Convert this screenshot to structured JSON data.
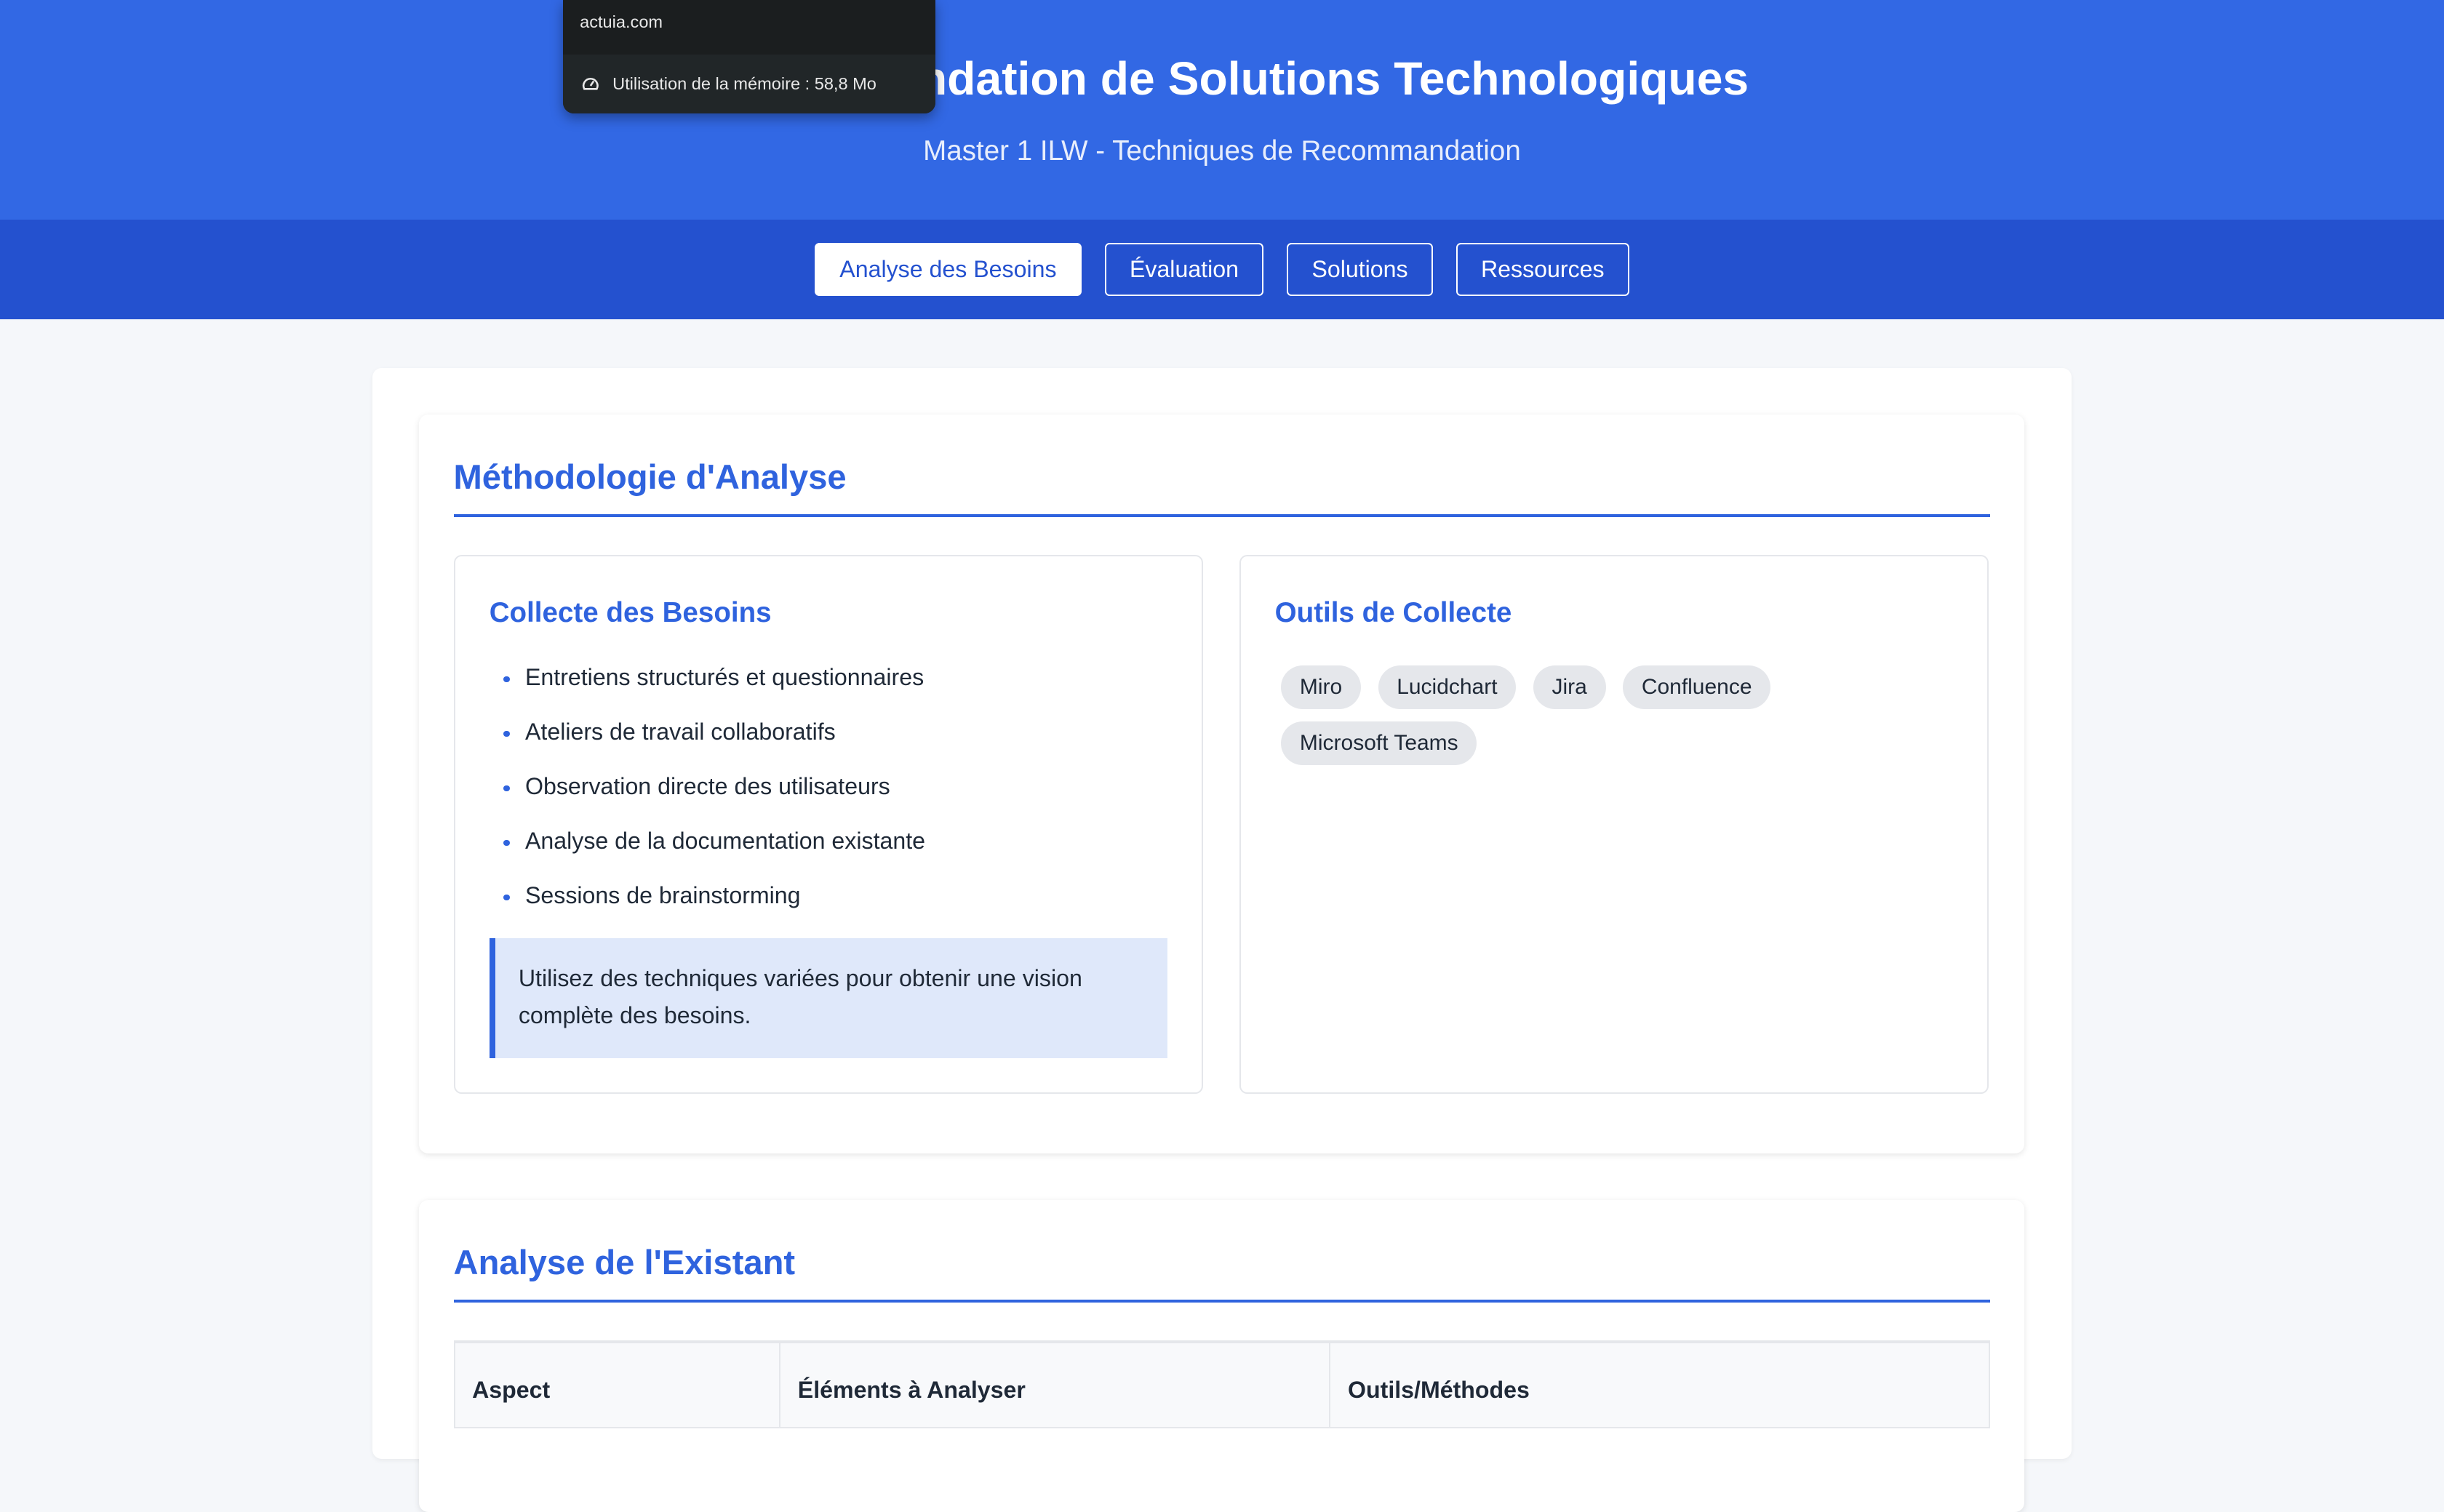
{
  "header": {
    "title": "Recommandation de Solutions Technologiques",
    "subtitle": "Master 1 ILW - Techniques de Recommandation"
  },
  "nav": {
    "tabs": [
      {
        "label": "Analyse des Besoins",
        "active": true
      },
      {
        "label": "Évaluation"
      },
      {
        "label": "Solutions"
      },
      {
        "label": "Ressources"
      }
    ]
  },
  "tooltip": {
    "site": "actuia.com",
    "memory": "Utilisation de la mémoire : 58,8 Mo"
  },
  "methodology": {
    "title": "Méthodologie d'Analyse",
    "collecte": {
      "title": "Collecte des Besoins",
      "items": [
        "Entretiens structurés et questionnaires",
        "Ateliers de travail collaboratifs",
        "Observation directe des utilisateurs",
        "Analyse de la documentation existante",
        "Sessions de brainstorming"
      ],
      "note": "Utilisez des techniques variées pour obtenir une vision complète des besoins."
    },
    "outils": {
      "title": "Outils de Collecte",
      "tags": [
        "Miro",
        "Lucidchart",
        "Jira",
        "Confluence",
        "Microsoft Teams"
      ]
    }
  },
  "existant": {
    "title": "Analyse de l'Existant",
    "columns": [
      "Aspect",
      "Éléments à Analyser",
      "Outils/Méthodes"
    ]
  },
  "colors": {
    "header": "#3268e4",
    "nav": "#2451cf",
    "accent": "#2f63de"
  }
}
